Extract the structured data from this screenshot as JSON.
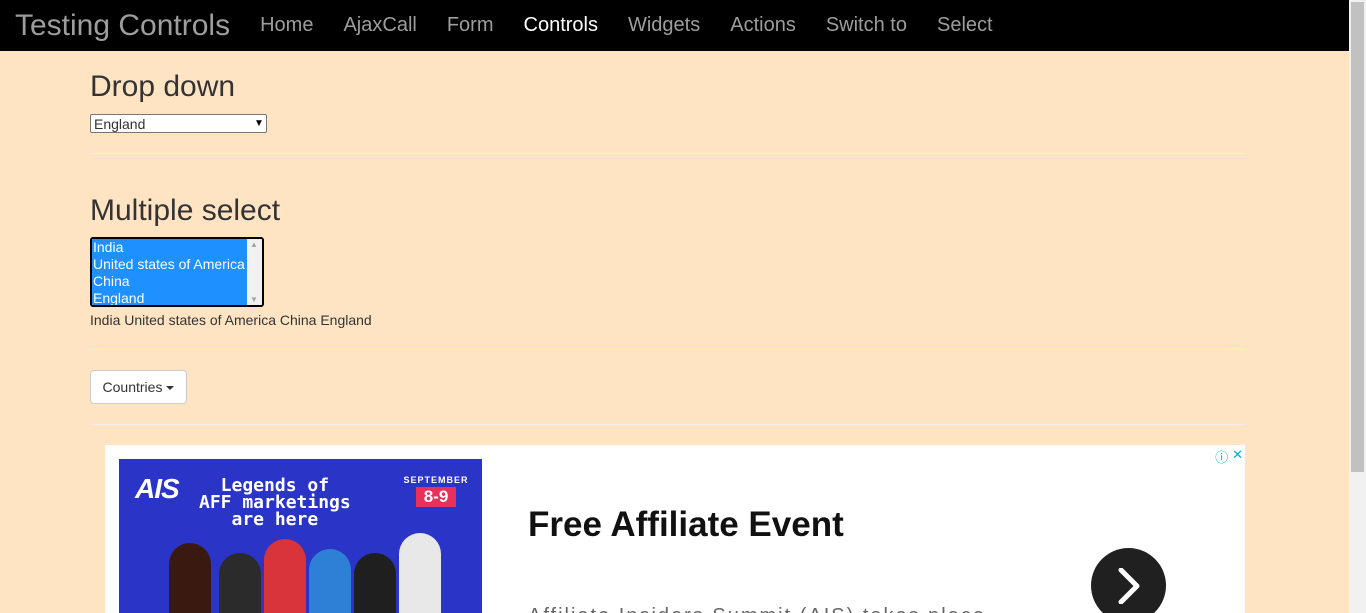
{
  "navbar": {
    "brand": "Testing Controls",
    "items": [
      {
        "label": "Home",
        "active": false
      },
      {
        "label": "AjaxCall",
        "active": false
      },
      {
        "label": "Form",
        "active": false
      },
      {
        "label": "Controls",
        "active": true
      },
      {
        "label": "Widgets",
        "active": false
      },
      {
        "label": "Actions",
        "active": false
      },
      {
        "label": "Switch to",
        "active": false
      },
      {
        "label": "Select",
        "active": false
      }
    ]
  },
  "dropdown": {
    "heading": "Drop down",
    "selected": "England"
  },
  "multiselect": {
    "heading": "Multiple select",
    "options": [
      "India",
      "United states of America",
      "China",
      "England"
    ],
    "selected_text": "India United states of America China England"
  },
  "countries_button": {
    "label": "Countries"
  },
  "ad": {
    "banner_logo": "AIS",
    "banner_line1": "Legends of",
    "banner_line2": "AFF marketings",
    "banner_line3": "are here",
    "banner_month": "SEPTEMBER",
    "banner_days": "8-9",
    "title": "Free Affiliate Event",
    "subtitle": "Affiliate Insiders Summit (AIS) takes place"
  },
  "colors": {
    "background": "#ffe4c4",
    "navbar": "#000000",
    "select_highlight": "#1e90ff",
    "ad_banner": "#2a34c6"
  }
}
